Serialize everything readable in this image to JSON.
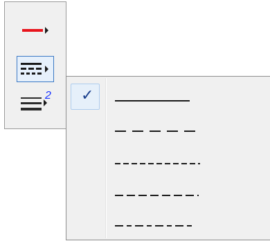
{
  "toolbar": {
    "buttons": [
      {
        "name": "line-color-button",
        "icon": "line-color-icon",
        "color": "#e8141c"
      },
      {
        "name": "dash-style-button",
        "icon": "dash-style-icon",
        "selected": true
      },
      {
        "name": "line-width-button",
        "icon": "line-width-icon",
        "badge": "2",
        "badge_color": "#1a35ff"
      }
    ]
  },
  "menu": {
    "items": [
      {
        "name": "solid",
        "dasharray": "none",
        "checked": true
      },
      {
        "name": "long-dash",
        "dasharray": "12 10"
      },
      {
        "name": "short-dash",
        "dasharray": "7 4"
      },
      {
        "name": "medium-dash",
        "dasharray": "11 6"
      },
      {
        "name": "dash-dot",
        "dasharray": "10 5"
      }
    ],
    "check_glyph": "✓"
  },
  "colors": {
    "accent": "#3a78c4",
    "line": "#1a1a1a"
  }
}
